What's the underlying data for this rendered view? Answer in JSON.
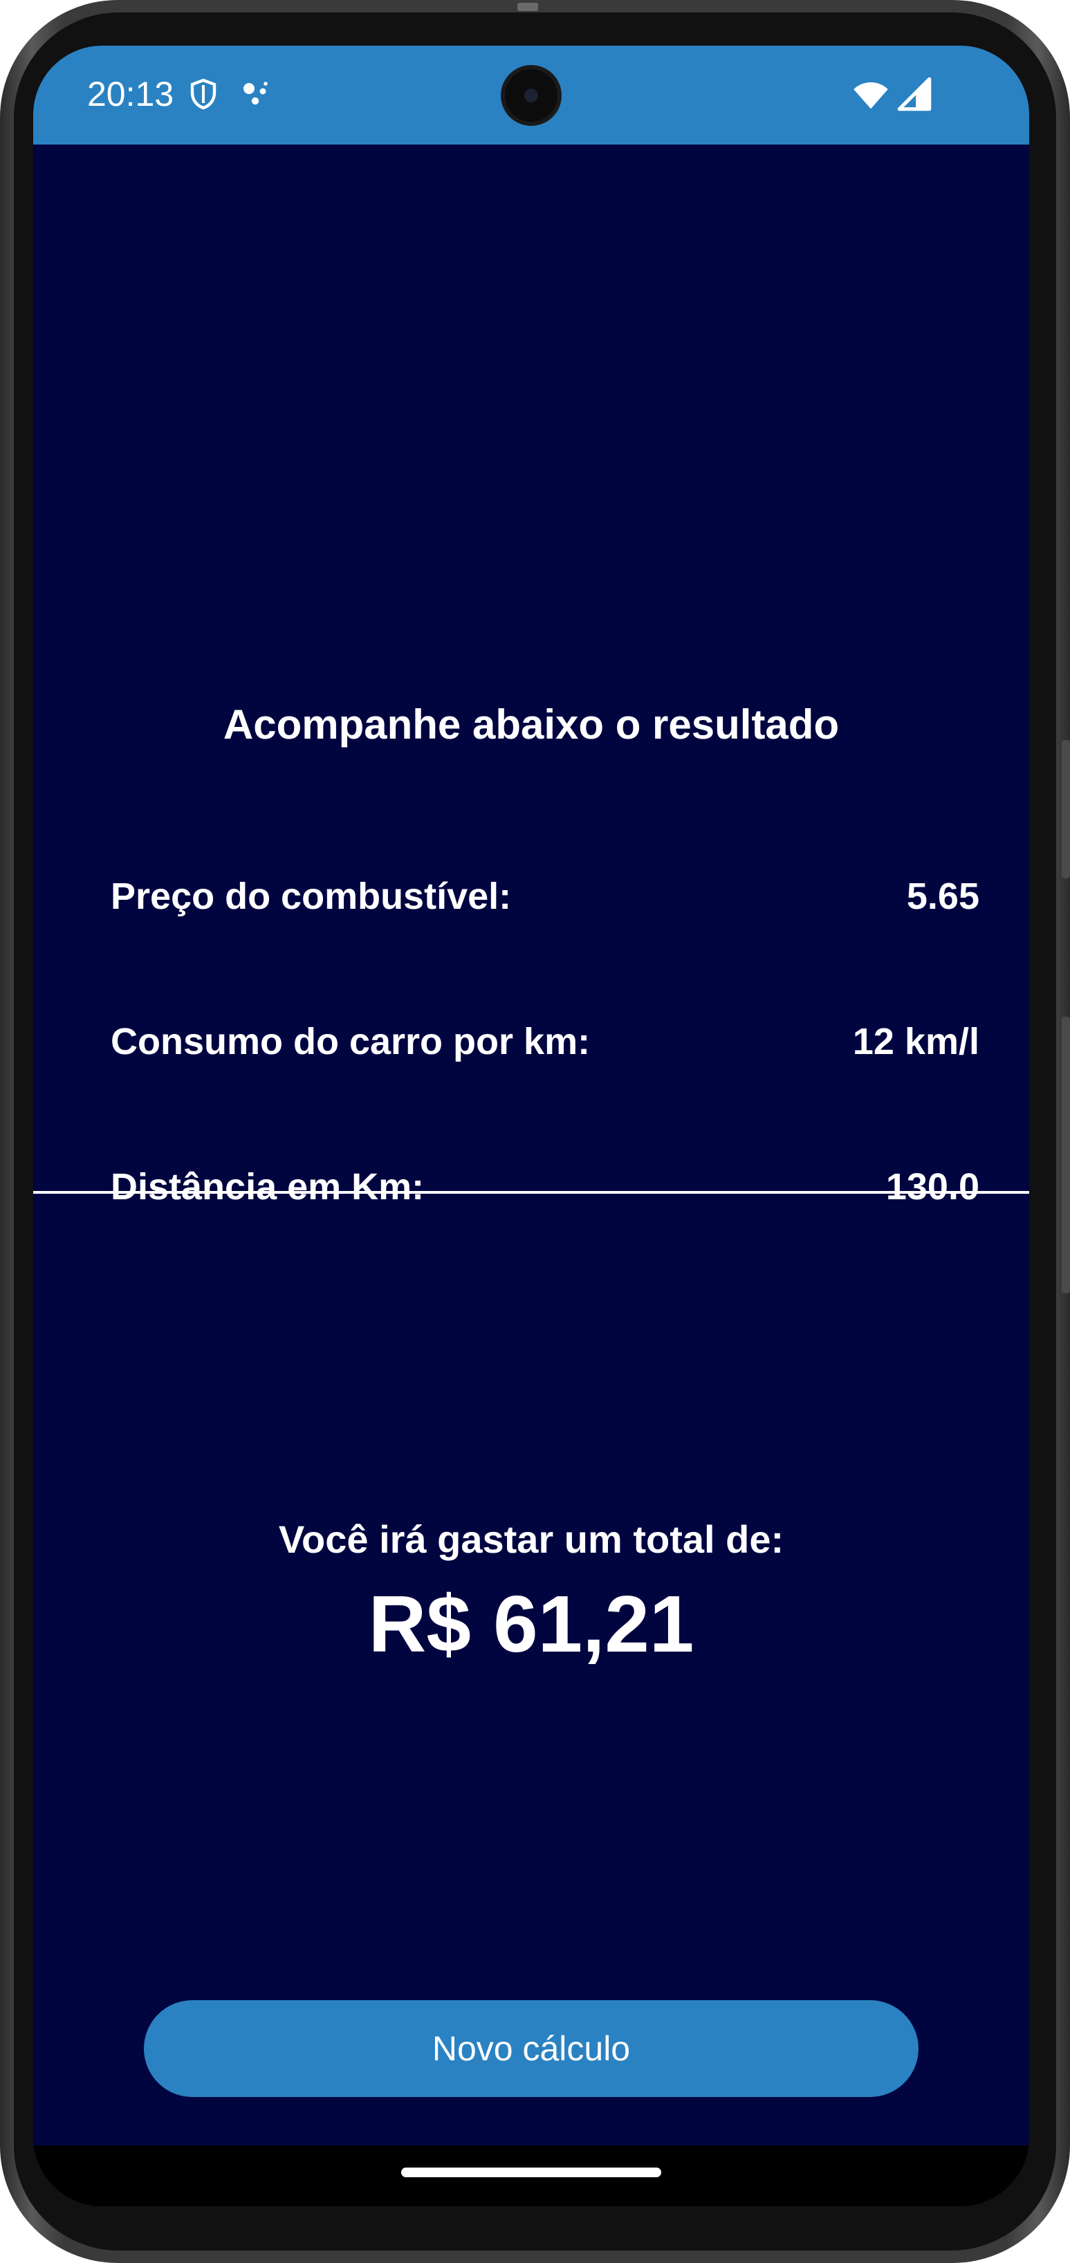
{
  "status_bar": {
    "time": "20:13",
    "icons": [
      "shield-icon",
      "assistant-dots-icon",
      "wifi-icon",
      "cellular-signal-icon"
    ],
    "background_color": "#2a82c2"
  },
  "result": {
    "heading": "Acompanhe abaixo o resultado",
    "rows": [
      {
        "label": "Preço do combustível:",
        "value": "5.65"
      },
      {
        "label": "Consumo do carro por km:",
        "value": "12 km/l"
      },
      {
        "label": "Distância em Km:",
        "value": "130.0"
      }
    ],
    "total_label": "Você irá gastar um total de:",
    "total_value": "R$ 61,21"
  },
  "actions": {
    "new_calc_label": "Novo cálculo"
  },
  "colors": {
    "background": "#000540",
    "accent": "#2a82c2",
    "text": "#ffffff"
  }
}
